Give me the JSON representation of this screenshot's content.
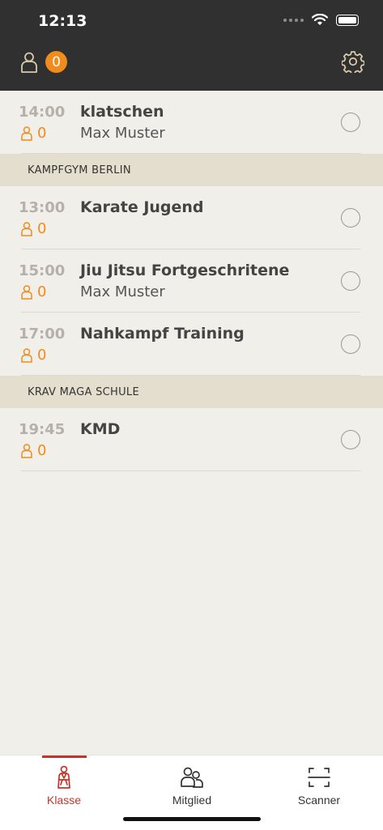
{
  "status_bar": {
    "time": "12:13"
  },
  "header": {
    "badge_count": "0"
  },
  "rows_top": [
    {
      "time": "14:00",
      "participants": "0",
      "title": "klatschen",
      "subtitle": "Max Muster"
    }
  ],
  "sections": [
    {
      "name": "KAMPFGYM BERLIN",
      "rows": [
        {
          "time": "13:00",
          "participants": "0",
          "title": "Karate Jugend",
          "subtitle": ""
        },
        {
          "time": "15:00",
          "participants": "0",
          "title": "Jiu Jitsu Fortgeschritene",
          "subtitle": "Max Muster"
        },
        {
          "time": "17:00",
          "participants": "0",
          "title": "Nahkampf Training",
          "subtitle": ""
        }
      ]
    },
    {
      "name": "KRAV MAGA SCHULE",
      "rows": [
        {
          "time": "19:45",
          "participants": "0",
          "title": "KMD",
          "subtitle": ""
        }
      ]
    }
  ],
  "tabs": [
    {
      "label": "Klasse"
    },
    {
      "label": "Mitglied"
    },
    {
      "label": "Scanner"
    }
  ],
  "colors": {
    "accent": "#f08c1c",
    "active_tab": "#c0362a",
    "header_bg": "#303030"
  }
}
